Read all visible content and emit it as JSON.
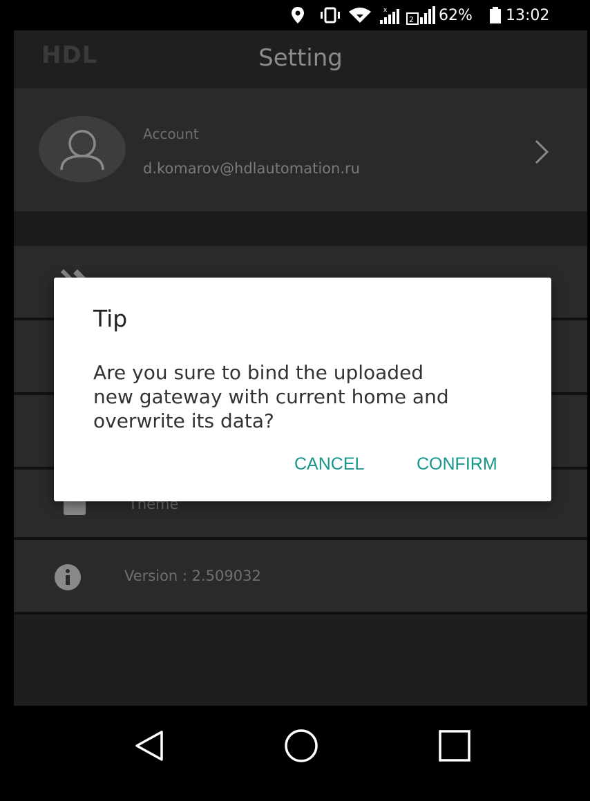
{
  "status_bar": {
    "battery_percent": "62%",
    "time": "13:02",
    "icons": [
      "location-icon",
      "vibrate-icon",
      "wifi-icon",
      "signal-sim1-icon",
      "signal-sim2-icon",
      "battery-icon"
    ]
  },
  "header": {
    "logo": "HDL",
    "title": "Setting"
  },
  "account": {
    "label": "Account",
    "email": "d.komarov@hdlautomation.ru"
  },
  "menu": {
    "theme_label": "Theme",
    "version_label": "Version : 2.509032"
  },
  "dialog": {
    "title": "Tip",
    "message_lines": [
      "Are you sure to bind the uploaded",
      "new gateway with current home and",
      "overwrite its data?"
    ],
    "cancel_label": "CANCEL",
    "confirm_label": "CONFIRM"
  },
  "colors": {
    "accent": "#16968a",
    "background": "#141414",
    "row": "#2a2a2a"
  }
}
